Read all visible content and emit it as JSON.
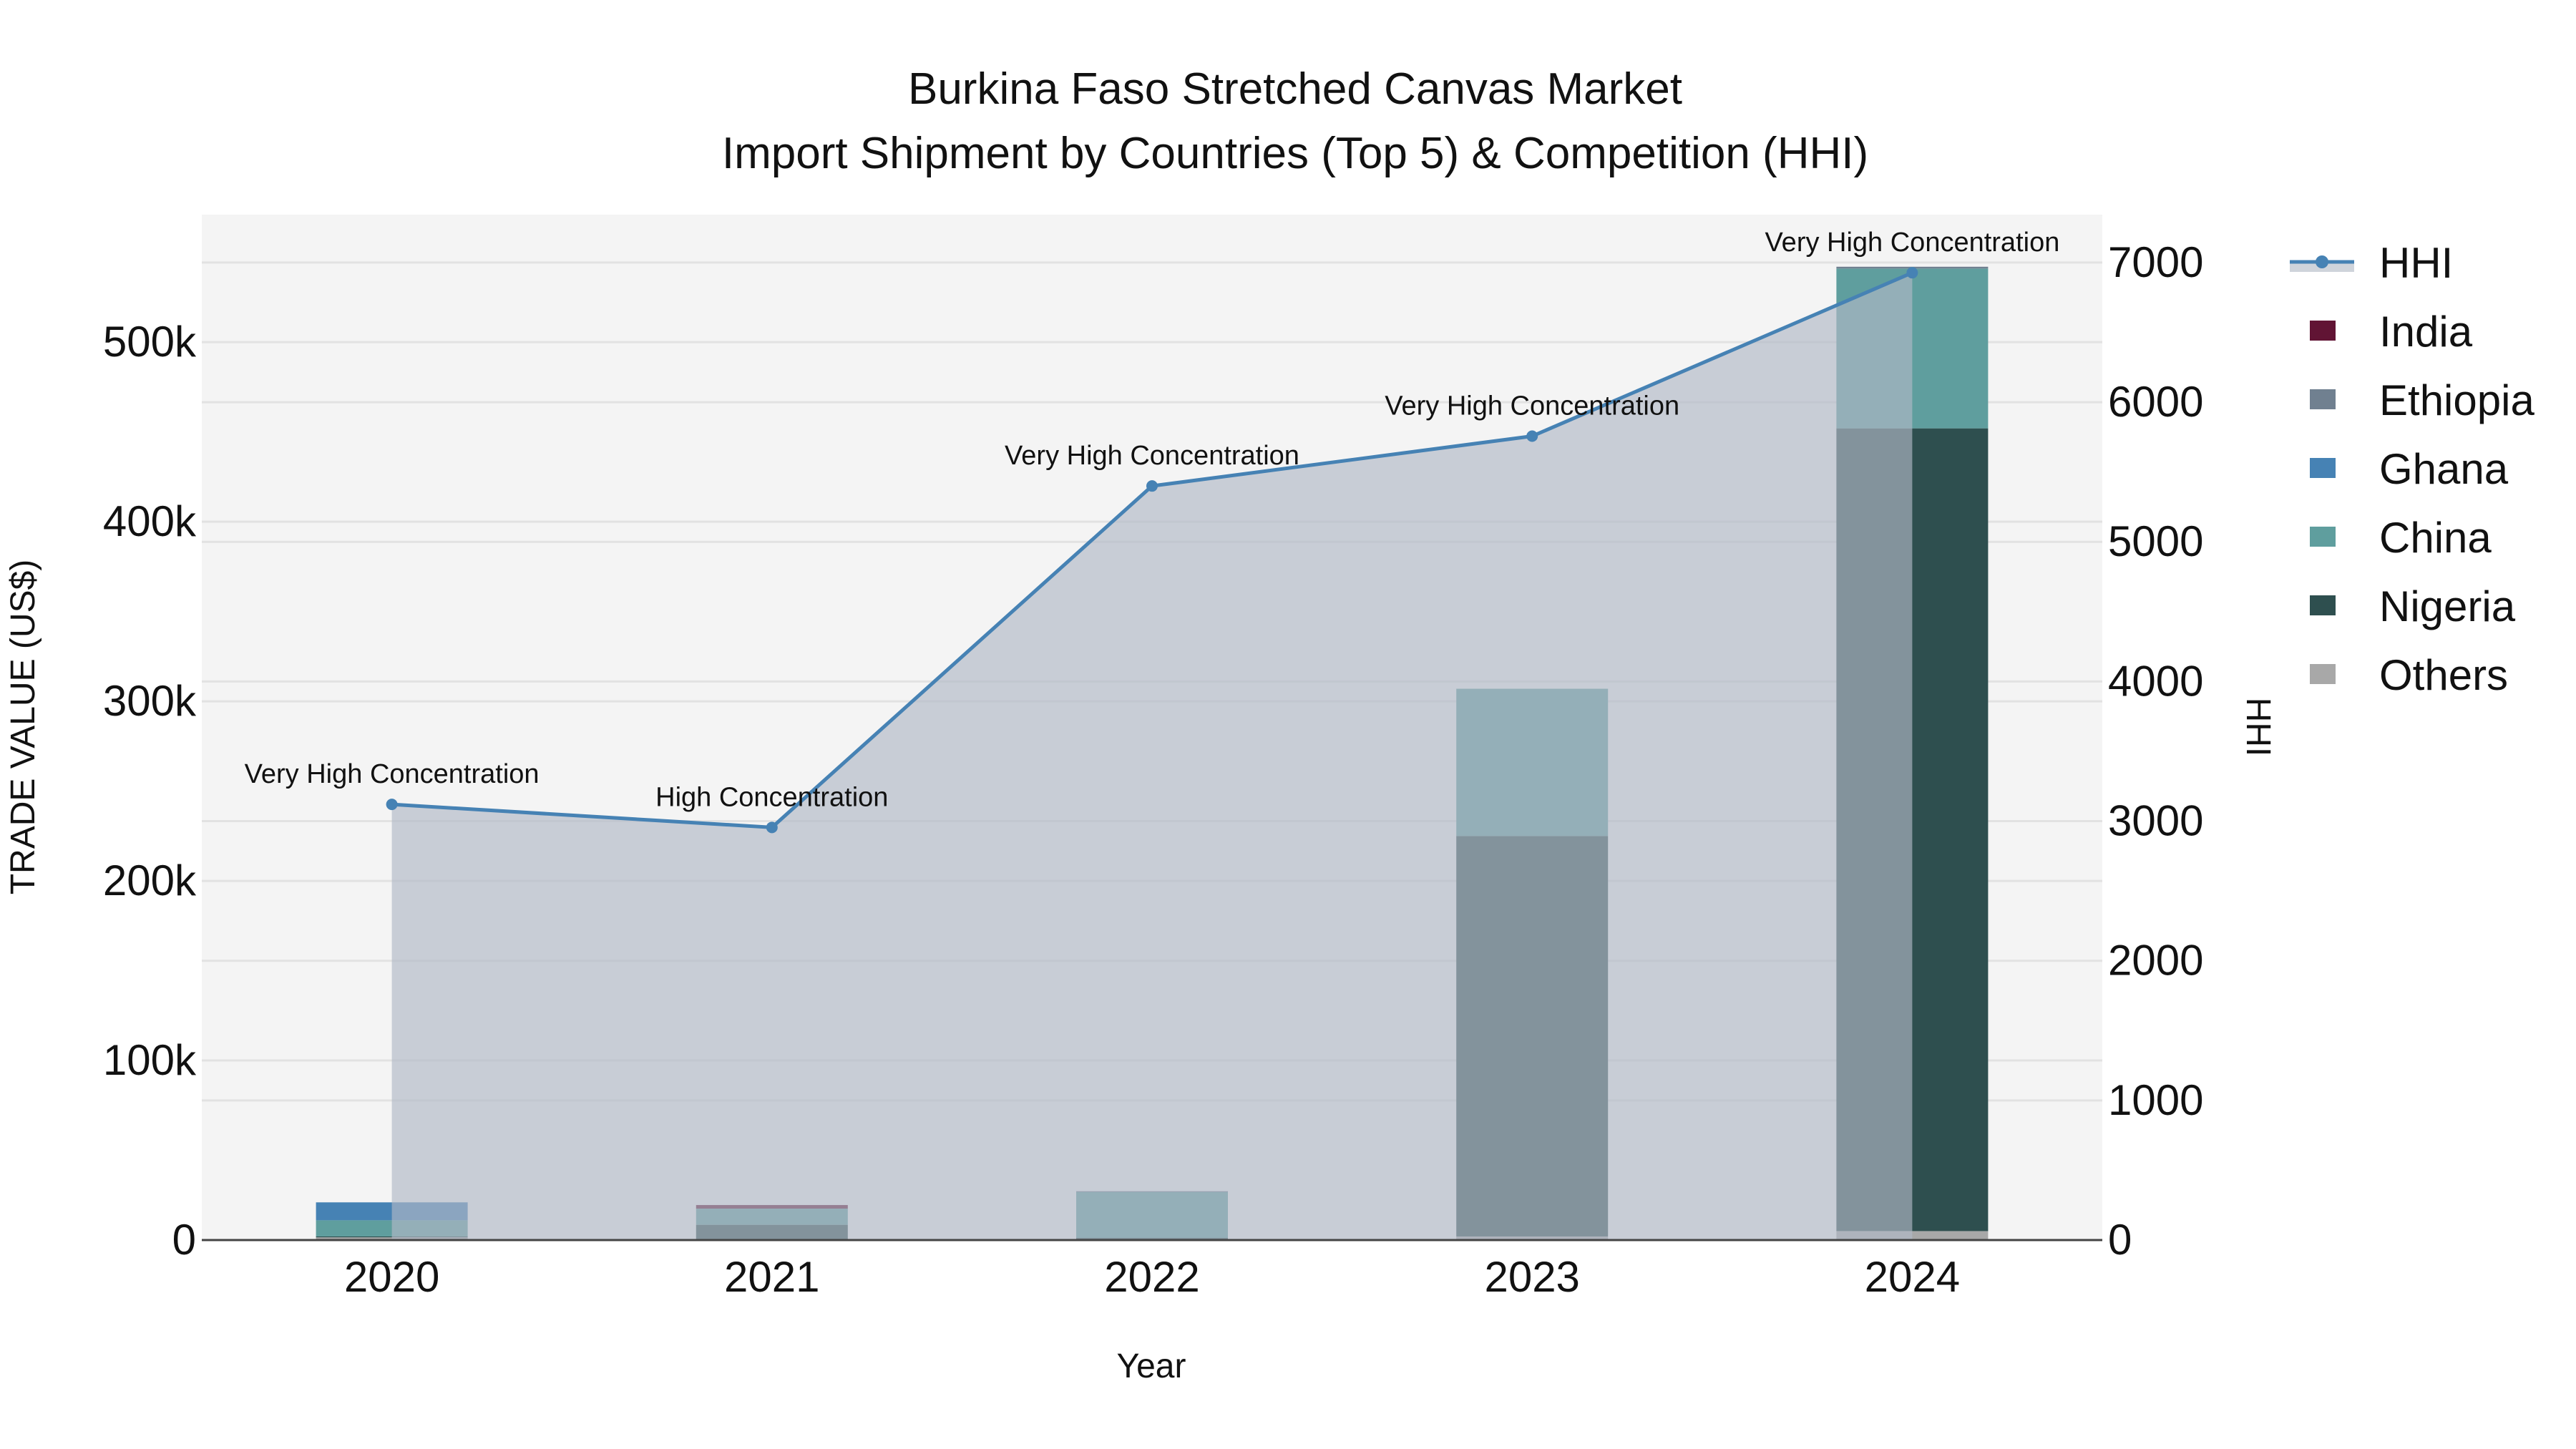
{
  "chart_data": {
    "type": "bar",
    "title": "Burkina Faso Stretched Canvas Market",
    "subtitle": "Import Shipment by Countries (Top 5) & Competition (HHI)",
    "xlabel": "Year",
    "ylabel": "TRADE VALUE (US$)",
    "y2label": "HHI",
    "categories": [
      "2020",
      "2021",
      "2022",
      "2023",
      "2024"
    ],
    "ylim": [
      0,
      571000
    ],
    "y2lim": [
      0,
      7343
    ],
    "yticks": [
      0,
      100000,
      200000,
      300000,
      400000,
      500000
    ],
    "ytick_labels": [
      "0",
      "100k",
      "200k",
      "300k",
      "400k",
      "500k"
    ],
    "y2ticks": [
      0,
      1000,
      2000,
      3000,
      4000,
      5000,
      6000,
      7000
    ],
    "y2tick_labels": [
      "0",
      "1000",
      "2000",
      "3000",
      "4000",
      "5000",
      "6000",
      "7000"
    ],
    "stacked": true,
    "series": [
      {
        "name": "Others",
        "color": "#a8a8a8",
        "values": [
          1500,
          500,
          500,
          2000,
          5000
        ]
      },
      {
        "name": "Nigeria",
        "color": "#2e4f4f",
        "values": [
          500,
          8000,
          700,
          223000,
          447000
        ]
      },
      {
        "name": "China",
        "color": "#5f9e9e",
        "values": [
          9000,
          9000,
          25500,
          82000,
          89000
        ]
      },
      {
        "name": "Ghana",
        "color": "#4682b4",
        "values": [
          10000,
          0,
          0,
          0,
          0
        ]
      },
      {
        "name": "Ethiopia",
        "color": "#708090",
        "values": [
          0,
          0,
          500,
          0,
          1000
        ]
      },
      {
        "name": "India",
        "color": "#611434",
        "values": [
          0,
          2000,
          0,
          0,
          0
        ]
      }
    ],
    "hhi": {
      "name": "HHI",
      "color": "#4682b4",
      "fill": "rgba(176,184,198,0.65)",
      "values": [
        3120,
        2955,
        5400,
        5757,
        6927
      ],
      "annotations": [
        "Very High Concentration",
        "High Concentration",
        "Very High Concentration",
        "Very High Concentration",
        "Very High Concentration"
      ]
    },
    "legend_order": [
      "HHI",
      "India",
      "Ethiopia",
      "Ghana",
      "China",
      "Nigeria",
      "Others"
    ],
    "legend_position": "right",
    "grid": true
  }
}
